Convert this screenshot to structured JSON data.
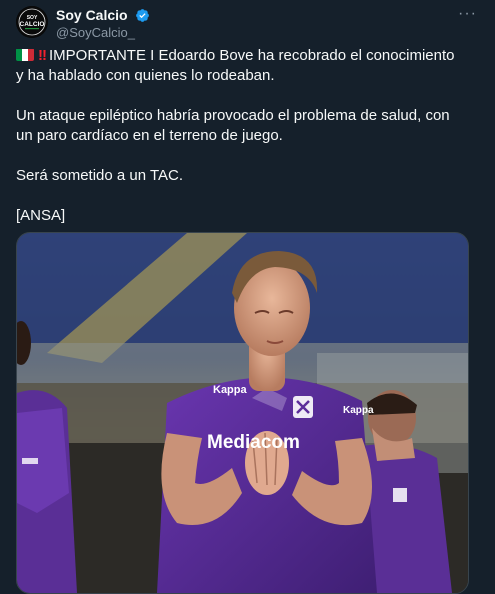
{
  "author": {
    "display_name": "Soy Calcio",
    "handle": "@SoyCalcio_",
    "avatar_text_top": "SOY",
    "avatar_text_main": "CALCIO",
    "verified_icon": "verified-badge-icon",
    "verified_color": "#1d9bf0"
  },
  "menu": {
    "more_icon": "more-horizontal-icon",
    "more_glyph": "···"
  },
  "tweet": {
    "alert_glyph": "!!",
    "line1": "IMPORTANTE I Edoardo Bove ha recobrado el conocimiento y ha hablado con quienes lo rodeaban.",
    "line2": "Un ataque epiléptico habría provocado el problema de salud, con un paro cardíaco en el terreno de juego.",
    "line3": "Será sometido a un TAC.",
    "line4": "[ANSA]"
  },
  "media": {
    "description_icon": "photo-player-icon",
    "jersey_sponsor": "Mediacom",
    "jersey_brand": "Kappa",
    "jersey_color": "#5b2d9a"
  },
  "colors": {
    "background": "#15202b",
    "text": "#f7f9f9",
    "muted": "#8b98a5"
  }
}
